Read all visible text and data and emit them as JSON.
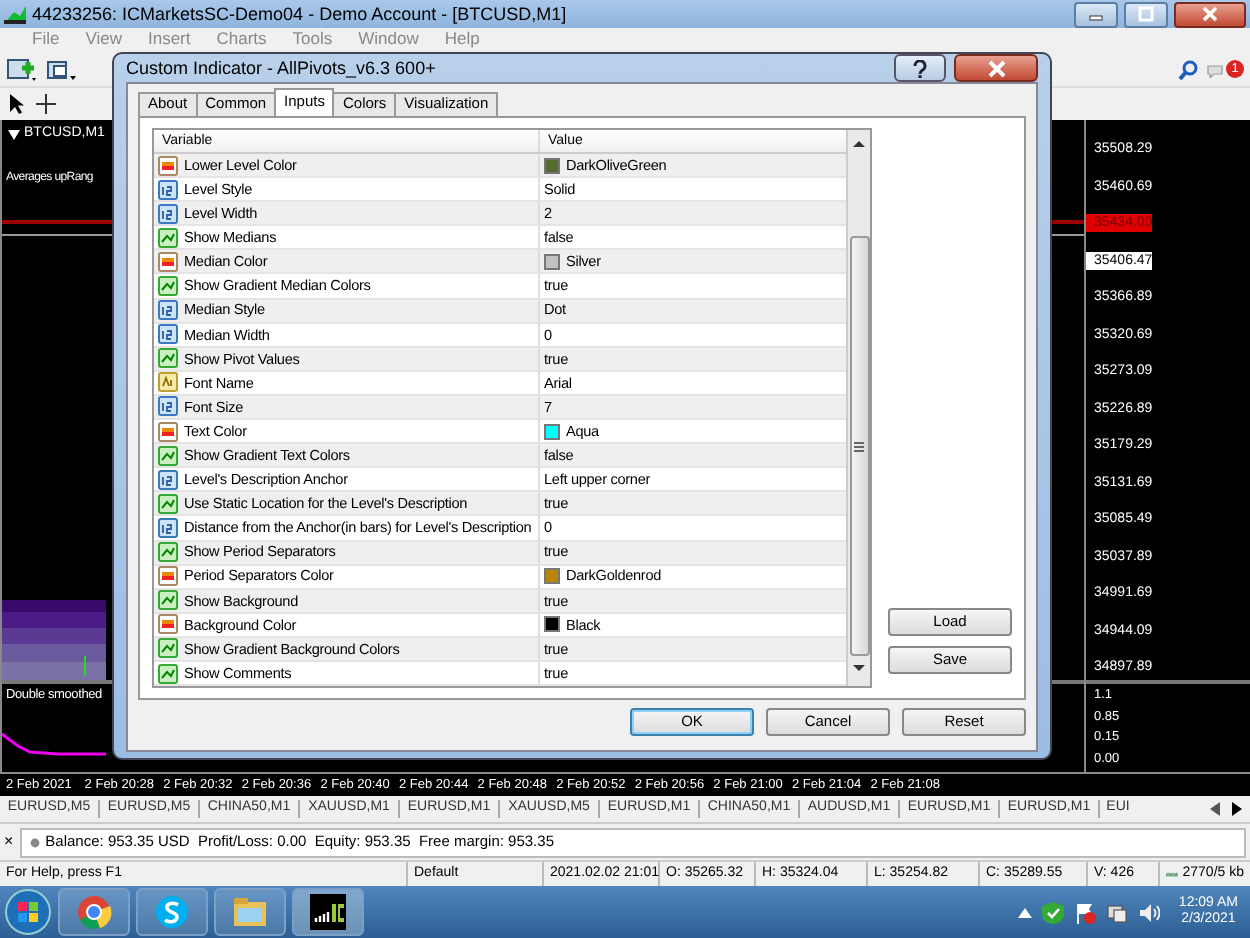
{
  "window": {
    "title": "44233256: ICMarketsSC-Demo04 - Demo Account - [BTCUSD,M1]"
  },
  "menu": [
    "File",
    "View",
    "Insert",
    "Charts",
    "Tools",
    "Window",
    "Help"
  ],
  "notification_count": "1",
  "chart": {
    "tab": "BTCUSD,M1",
    "indicator_label": "Averages upRang",
    "subwindow_label": "Double smoothed",
    "price_labels": [
      {
        "text": "35508.29",
        "kind": "tick"
      },
      {
        "text": "35460.69",
        "kind": "tick"
      },
      {
        "text": "35434.00",
        "kind": "bid"
      },
      {
        "text": "35406.47",
        "kind": "last"
      },
      {
        "text": "35366.89",
        "kind": "tick"
      },
      {
        "text": "35320.69",
        "kind": "tick"
      },
      {
        "text": "35273.09",
        "kind": "tick"
      },
      {
        "text": "35226.89",
        "kind": "tick"
      },
      {
        "text": "35179.29",
        "kind": "tick"
      },
      {
        "text": "35131.69",
        "kind": "tick"
      },
      {
        "text": "35085.49",
        "kind": "tick"
      },
      {
        "text": "35037.89",
        "kind": "tick"
      },
      {
        "text": "34991.69",
        "kind": "tick"
      },
      {
        "text": "34944.09",
        "kind": "tick"
      },
      {
        "text": "34897.89",
        "kind": "tick"
      }
    ],
    "sub_labels": [
      "1.1",
      "0.85",
      "0.15",
      "0.00"
    ],
    "time_labels": [
      "2 Feb 2021",
      "2 Feb 20:28",
      "2 Feb 20:32",
      "2 Feb 20:36",
      "2 Feb 20:40",
      "2 Feb 20:44",
      "2 Feb 20:48",
      "2 Feb 20:52",
      "2 Feb 20:56",
      "2 Feb 21:00",
      "2 Feb 21:04",
      "2 Feb 21:08"
    ]
  },
  "dialog": {
    "title": "Custom Indicator - AllPivots_v6.3 600+",
    "tabs": [
      {
        "label": "About",
        "selected": false
      },
      {
        "label": "Common",
        "selected": false
      },
      {
        "label": "Inputs",
        "selected": true
      },
      {
        "label": "Colors",
        "selected": false
      },
      {
        "label": "Visualization",
        "selected": false
      }
    ],
    "columns": [
      "Variable",
      "Value"
    ],
    "rows": [
      {
        "kind": "color",
        "variable": "Lower Level Color",
        "value": "DarkOliveGreen",
        "color": "#556b2f"
      },
      {
        "kind": "number",
        "variable": "Level Style",
        "value": "Solid"
      },
      {
        "kind": "number",
        "variable": "Level Width",
        "value": "2"
      },
      {
        "kind": "bool",
        "variable": "Show Medians",
        "value": "false"
      },
      {
        "kind": "color",
        "variable": "Median Color",
        "value": "Silver",
        "color": "#c0c0c0"
      },
      {
        "kind": "bool",
        "variable": "Show Gradient Median Colors",
        "value": "true"
      },
      {
        "kind": "number",
        "variable": "Median Style",
        "value": "Dot"
      },
      {
        "kind": "number",
        "variable": "Median Width",
        "value": "0"
      },
      {
        "kind": "bool",
        "variable": "Show Pivot Values",
        "value": "true"
      },
      {
        "kind": "string",
        "variable": "Font Name",
        "value": "Arial"
      },
      {
        "kind": "number",
        "variable": "Font Size",
        "value": "7"
      },
      {
        "kind": "color",
        "variable": "Text Color",
        "value": "Aqua",
        "color": "#00ffff"
      },
      {
        "kind": "bool",
        "variable": "Show Gradient Text Colors",
        "value": "false"
      },
      {
        "kind": "number",
        "variable": "Level's Description Anchor",
        "value": "Left upper corner"
      },
      {
        "kind": "bool",
        "variable": "Use Static Location for the Level's Description",
        "value": "true"
      },
      {
        "kind": "number",
        "variable": "Distance from the Anchor(in bars) for Level's Description",
        "value": "0"
      },
      {
        "kind": "bool",
        "variable": "Show Period Separators",
        "value": "true"
      },
      {
        "kind": "color",
        "variable": "Period Separators Color",
        "value": "DarkGoldenrod",
        "color": "#b8860b"
      },
      {
        "kind": "bool",
        "variable": "Show Background",
        "value": "true"
      },
      {
        "kind": "color",
        "variable": "Background Color",
        "value": "Black",
        "color": "#000000"
      },
      {
        "kind": "bool",
        "variable": "Show Gradient Background Colors",
        "value": "true"
      },
      {
        "kind": "bool",
        "variable": "Show Comments",
        "value": "true"
      }
    ],
    "side_buttons": [
      "Load",
      "Save"
    ],
    "footer_buttons": [
      {
        "label": "OK",
        "default": true
      },
      {
        "label": "Cancel",
        "default": false
      },
      {
        "label": "Reset",
        "default": false
      }
    ]
  },
  "symbol_tabs": [
    "EURUSD,M5",
    "EURUSD,M5",
    "CHINA50,M1",
    "XAUUSD,M1",
    "EURUSD,M1",
    "XAUUSD,M5",
    "EURUSD,M1",
    "CHINA50,M1",
    "AUDUSD,M1",
    "EURUSD,M1",
    "EURUSD,M1",
    "EUI"
  ],
  "terminal": {
    "close": "×",
    "text": "Balance: 953.35 USD  Profit/Loss: 0.00  Equity: 953.35  Free margin: 953.35"
  },
  "status_bar": [
    "For Help, press F1",
    "Default",
    "2021.02.02 21:01",
    "O: 35265.32",
    "H: 35324.04",
    "L: 35254.82",
    "C: 35289.55",
    "V: 426",
    "2770/5 kb"
  ],
  "taskbar": {
    "time": "12:09 AM",
    "date": "2/3/2021"
  }
}
